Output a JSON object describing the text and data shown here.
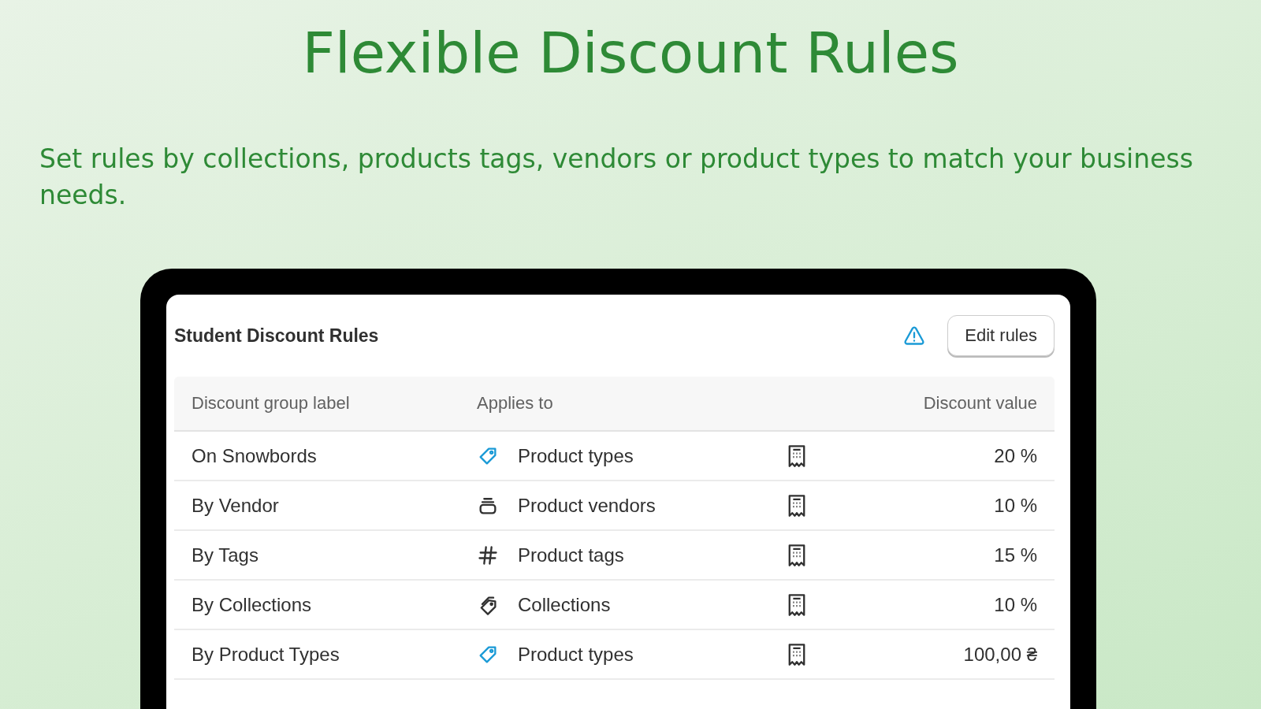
{
  "heading": "Flexible Discount Rules",
  "subheading": "Set rules by collections, products tags, vendors or product types to match your business needs.",
  "card": {
    "title": "Student Discount Rules",
    "button": "Edit rules",
    "table": {
      "columns": [
        "Discount group label",
        "Applies to",
        "Discount value"
      ],
      "rows": [
        {
          "label": "On Snowbords",
          "kind": "tag",
          "applies_to": "Product types",
          "value": "20 %"
        },
        {
          "label": "By Vendor",
          "kind": "stack",
          "applies_to": "Product vendors",
          "value": "10 %"
        },
        {
          "label": "By Tags",
          "kind": "hash",
          "applies_to": "Product tags",
          "value": "15 %"
        },
        {
          "label": "By Collections",
          "kind": "tags",
          "applies_to": "Collections",
          "value": "10 %"
        },
        {
          "label": "By Product Types",
          "kind": "tag",
          "applies_to": "Product types",
          "value": "100,00 ₴"
        }
      ]
    }
  }
}
